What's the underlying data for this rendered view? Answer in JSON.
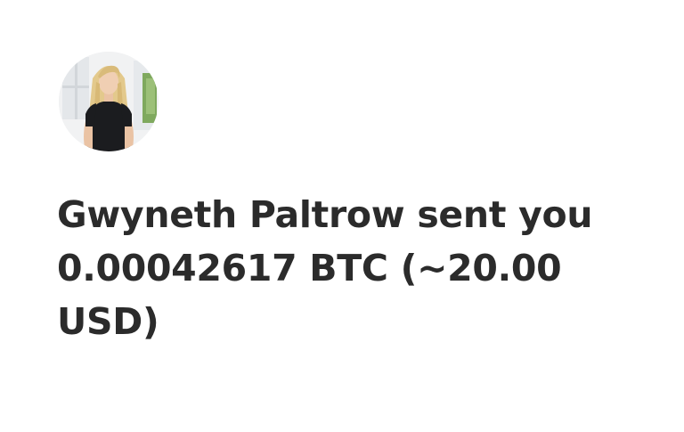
{
  "notification": {
    "sender_name": "Gwyneth Paltrow",
    "message": "Gwyneth Paltrow sent you 0.00042617 BTC (~20.00 USD)",
    "amount": "0.00042617",
    "currency": "BTC",
    "fiat_equivalent": "~20.00 USD"
  },
  "avatar": {
    "icon": "sender-avatar-photo"
  },
  "colors": {
    "text": "#2b2b2b",
    "background": "#ffffff"
  }
}
